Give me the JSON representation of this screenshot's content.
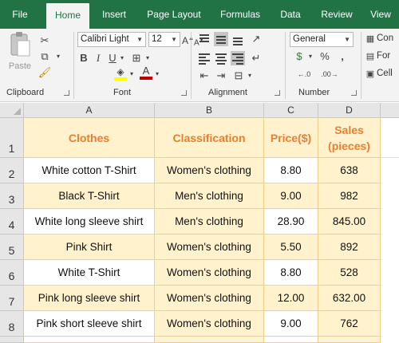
{
  "tabs": [
    {
      "label": "File",
      "active": false
    },
    {
      "label": "Home",
      "active": true
    },
    {
      "label": "Insert",
      "active": false
    },
    {
      "label": "Page Layout",
      "active": false
    },
    {
      "label": "Formulas",
      "active": false
    },
    {
      "label": "Data",
      "active": false
    },
    {
      "label": "Review",
      "active": false
    },
    {
      "label": "View",
      "active": false
    }
  ],
  "ribbon": {
    "clipboard": {
      "label": "Clipboard",
      "paste_label": "Paste"
    },
    "font": {
      "label": "Font",
      "font_name": "Calibri Light",
      "font_size": "12",
      "bold": "B",
      "italic": "I",
      "underline": "U",
      "grow": "A",
      "shrink": "A"
    },
    "alignment": {
      "label": "Alignment"
    },
    "number": {
      "label": "Number",
      "format": "General",
      "percent": "%",
      "comma": ","
    },
    "styles": {
      "item1": "Con",
      "item2": "For",
      "item3": "Cell"
    }
  },
  "columns": [
    "A",
    "B",
    "C",
    "D"
  ],
  "rows": [
    "1",
    "2",
    "3",
    "4",
    "5",
    "6",
    "7",
    "8"
  ],
  "table": {
    "headers": [
      "Clothes",
      "Classification",
      "Price($)",
      "Sales",
      "(pieces)"
    ],
    "rows": [
      [
        "White cotton T-Shirt",
        "Women's clothing",
        "8.80",
        "638"
      ],
      [
        "Black T-Shirt",
        "Men's clothing",
        "9.00",
        "982"
      ],
      [
        "White long sleeve shirt",
        "Men's clothing",
        "28.90",
        "845.00"
      ],
      [
        "Pink Shirt",
        "Women's clothing",
        "5.50",
        "892"
      ],
      [
        "White T-Shirt",
        "Women's clothing",
        "8.80",
        "528"
      ],
      [
        "Pink long sleeve shirt",
        "Women's clothing",
        "12.00",
        "632.00"
      ],
      [
        "Pink short sleeve shirt",
        "Women's clothing",
        "9.00",
        "762"
      ]
    ]
  },
  "colors": {
    "ribbon_tab": "#217346",
    "header_text": "#ed7d31",
    "cell_fill": "#fff2cc",
    "grid_line": "#f3d08a",
    "highlight": "#ffff00",
    "font_color": "#c00000"
  }
}
